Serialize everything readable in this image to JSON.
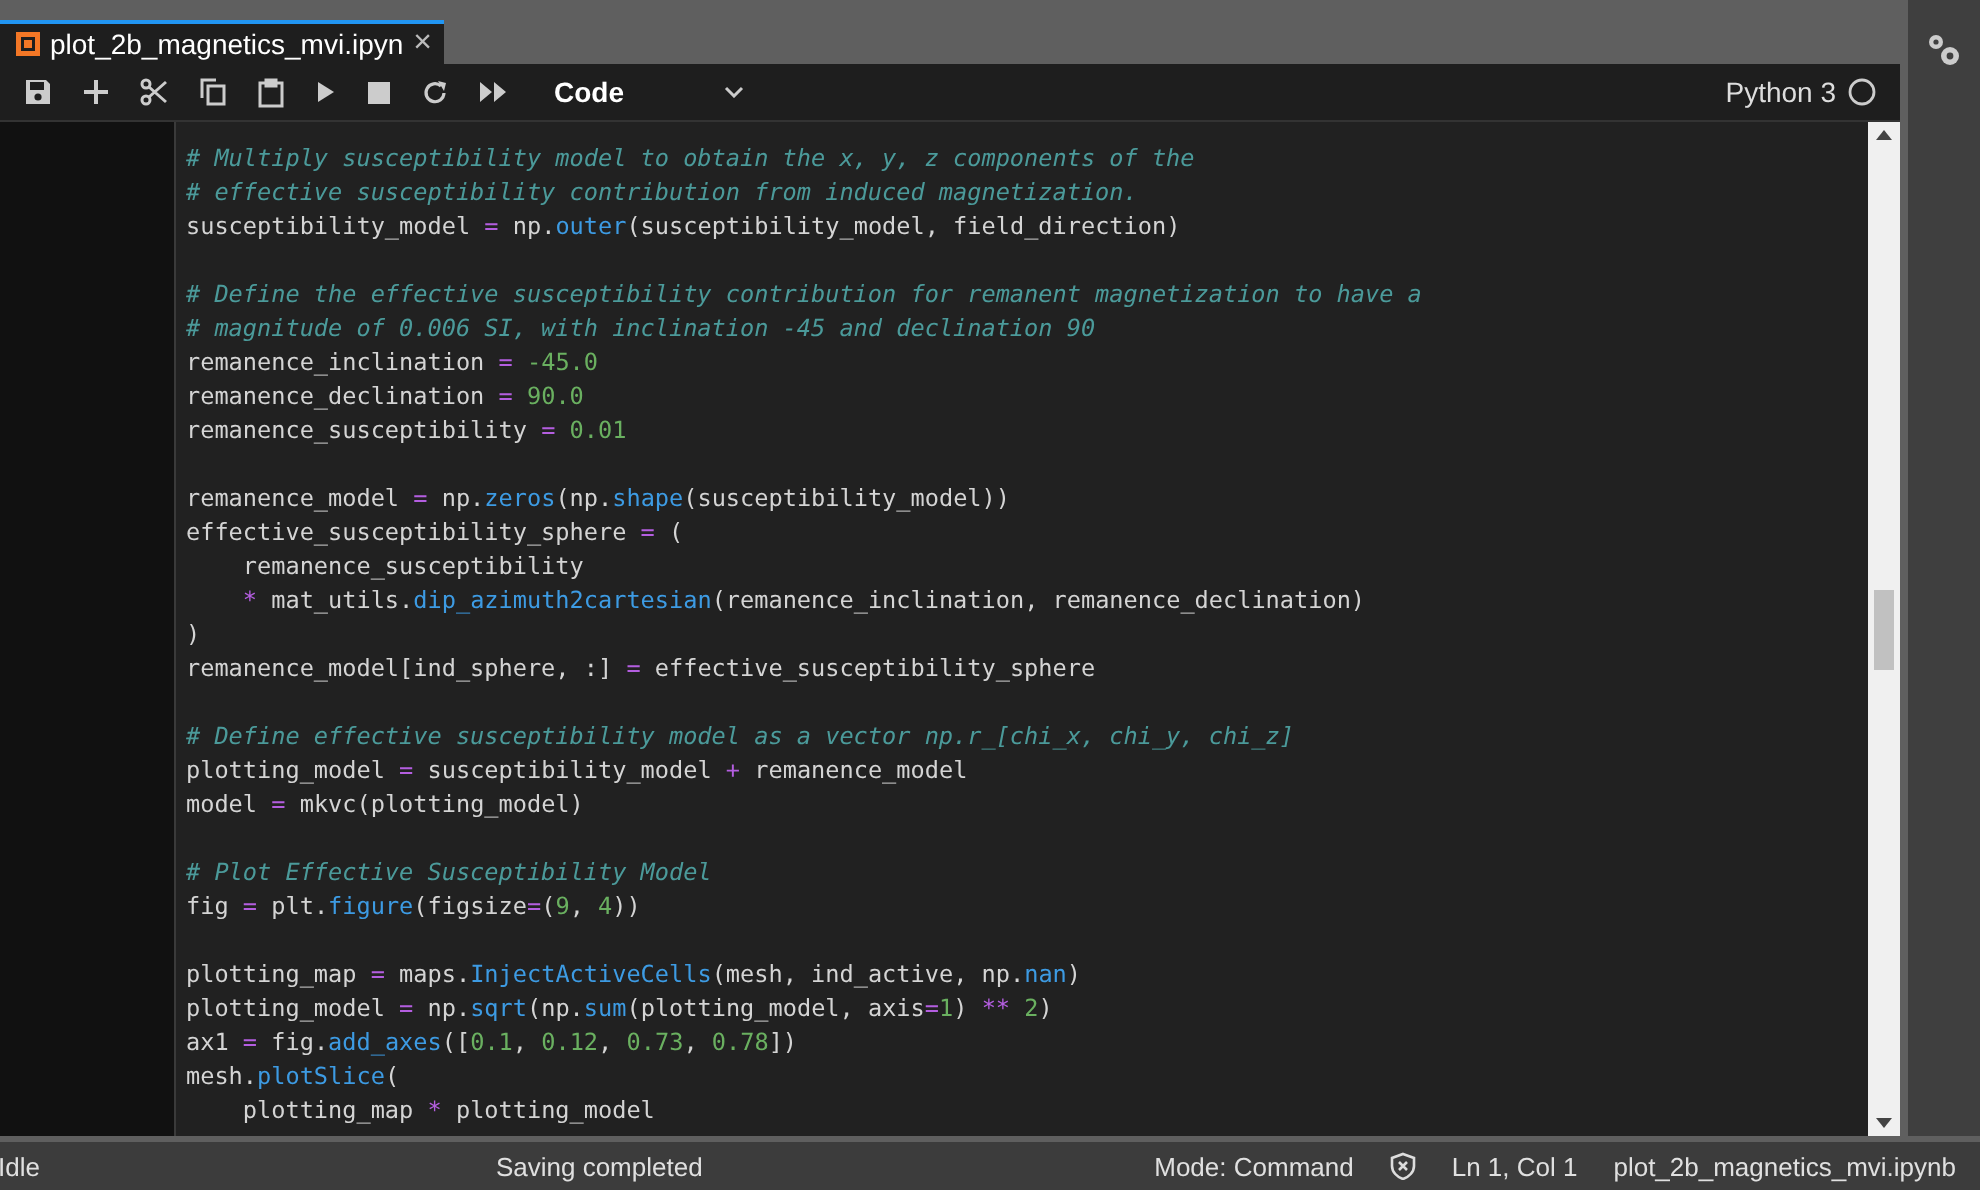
{
  "tabs": [
    {
      "label": "plot_2b_magnetics_mvi.ipyn",
      "close": "×",
      "selected": true
    }
  ],
  "toolbar": {
    "cell_type": "Code",
    "kernel": "Python 3",
    "kernel_busy": false
  },
  "editor": {
    "lines": [
      {
        "kind": "code",
        "tokens": [
          {
            "kind": "comment",
            "text": "# Multiply susceptibility model to obtain the x, y, z components of the"
          }
        ]
      },
      {
        "kind": "code",
        "tokens": [
          {
            "kind": "comment",
            "text": "# effective susceptibility contribution from induced magnetization."
          }
        ]
      },
      {
        "kind": "code",
        "tokens": [
          {
            "kind": "name",
            "text": "susceptibility_model "
          },
          {
            "kind": "op",
            "text": "="
          },
          {
            "kind": "name",
            "text": " np."
          },
          {
            "kind": "func",
            "text": "outer"
          },
          {
            "kind": "name",
            "text": "(susceptibility_model, field_direction)"
          }
        ]
      },
      {
        "kind": "blank"
      },
      {
        "kind": "code",
        "tokens": [
          {
            "kind": "comment",
            "text": "# Define the effective susceptibility contribution for remanent magnetization to have a"
          }
        ]
      },
      {
        "kind": "code",
        "tokens": [
          {
            "kind": "comment",
            "text": "# magnitude of 0.006 SI, with inclination -45 and declination 90"
          }
        ]
      },
      {
        "kind": "code",
        "tokens": [
          {
            "kind": "name",
            "text": "remanence_inclination "
          },
          {
            "kind": "op",
            "text": "= "
          },
          {
            "kind": "num",
            "text": "-45.0"
          }
        ]
      },
      {
        "kind": "code",
        "tokens": [
          {
            "kind": "name",
            "text": "remanence_declination "
          },
          {
            "kind": "op",
            "text": "= "
          },
          {
            "kind": "num",
            "text": "90.0"
          }
        ]
      },
      {
        "kind": "code",
        "tokens": [
          {
            "kind": "name",
            "text": "remanence_susceptibility "
          },
          {
            "kind": "op",
            "text": "= "
          },
          {
            "kind": "num",
            "text": "0.01"
          }
        ]
      },
      {
        "kind": "blank"
      },
      {
        "kind": "code",
        "tokens": [
          {
            "kind": "name",
            "text": "remanence_model "
          },
          {
            "kind": "op",
            "text": "="
          },
          {
            "kind": "name",
            "text": " np."
          },
          {
            "kind": "func",
            "text": "zeros"
          },
          {
            "kind": "name",
            "text": "(np."
          },
          {
            "kind": "func",
            "text": "shape"
          },
          {
            "kind": "name",
            "text": "(susceptibility_model))"
          }
        ]
      },
      {
        "kind": "code",
        "tokens": [
          {
            "kind": "name",
            "text": "effective_susceptibility_sphere "
          },
          {
            "kind": "op",
            "text": "="
          },
          {
            "kind": "name",
            "text": " ("
          }
        ]
      },
      {
        "kind": "code",
        "tokens": [
          {
            "kind": "name",
            "text": "    remanence_susceptibility"
          }
        ]
      },
      {
        "kind": "code",
        "tokens": [
          {
            "kind": "op",
            "text": "    *"
          },
          {
            "kind": "name",
            "text": " mat_utils."
          },
          {
            "kind": "func",
            "text": "dip_azimuth2cartesian"
          },
          {
            "kind": "name",
            "text": "(remanence_inclination, remanence_declination)"
          }
        ]
      },
      {
        "kind": "code",
        "tokens": [
          {
            "kind": "name",
            "text": ")"
          }
        ]
      },
      {
        "kind": "code",
        "tokens": [
          {
            "kind": "name",
            "text": "remanence_model[ind_sphere, :] "
          },
          {
            "kind": "op",
            "text": "="
          },
          {
            "kind": "name",
            "text": " effective_susceptibility_sphere"
          }
        ]
      },
      {
        "kind": "blank"
      },
      {
        "kind": "code",
        "tokens": [
          {
            "kind": "comment",
            "text": "# Define effective susceptibility model as a vector np.r_[chi_x, chi_y, chi_z]"
          }
        ]
      },
      {
        "kind": "code",
        "tokens": [
          {
            "kind": "name",
            "text": "plotting_model "
          },
          {
            "kind": "op",
            "text": "="
          },
          {
            "kind": "name",
            "text": " susceptibility_model "
          },
          {
            "kind": "op",
            "text": "+"
          },
          {
            "kind": "name",
            "text": " remanence_model"
          }
        ]
      },
      {
        "kind": "code",
        "tokens": [
          {
            "kind": "name",
            "text": "model "
          },
          {
            "kind": "op",
            "text": "="
          },
          {
            "kind": "name",
            "text": " mkvc(plotting_model)"
          }
        ]
      },
      {
        "kind": "blank"
      },
      {
        "kind": "code",
        "tokens": [
          {
            "kind": "comment",
            "text": "# Plot Effective Susceptibility Model"
          }
        ]
      },
      {
        "kind": "code",
        "tokens": [
          {
            "kind": "name",
            "text": "fig "
          },
          {
            "kind": "op",
            "text": "="
          },
          {
            "kind": "name",
            "text": " plt."
          },
          {
            "kind": "func",
            "text": "figure"
          },
          {
            "kind": "name",
            "text": "(figsize"
          },
          {
            "kind": "op",
            "text": "="
          },
          {
            "kind": "name",
            "text": "("
          },
          {
            "kind": "num",
            "text": "9"
          },
          {
            "kind": "name",
            "text": ", "
          },
          {
            "kind": "num",
            "text": "4"
          },
          {
            "kind": "name",
            "text": "))"
          }
        ]
      },
      {
        "kind": "blank"
      },
      {
        "kind": "code",
        "tokens": [
          {
            "kind": "name",
            "text": "plotting_map "
          },
          {
            "kind": "op",
            "text": "="
          },
          {
            "kind": "name",
            "text": " maps."
          },
          {
            "kind": "func",
            "text": "InjectActiveCells"
          },
          {
            "kind": "name",
            "text": "(mesh, ind_active, np."
          },
          {
            "kind": "func",
            "text": "nan"
          },
          {
            "kind": "name",
            "text": ")"
          }
        ]
      },
      {
        "kind": "code",
        "tokens": [
          {
            "kind": "name",
            "text": "plotting_model "
          },
          {
            "kind": "op",
            "text": "="
          },
          {
            "kind": "name",
            "text": " np."
          },
          {
            "kind": "func",
            "text": "sqrt"
          },
          {
            "kind": "name",
            "text": "(np."
          },
          {
            "kind": "func",
            "text": "sum"
          },
          {
            "kind": "name",
            "text": "(plotting_model, axis"
          },
          {
            "kind": "op",
            "text": "="
          },
          {
            "kind": "num",
            "text": "1"
          },
          {
            "kind": "name",
            "text": ") "
          },
          {
            "kind": "op",
            "text": "** "
          },
          {
            "kind": "num",
            "text": "2"
          },
          {
            "kind": "name",
            "text": ")"
          }
        ]
      },
      {
        "kind": "code",
        "tokens": [
          {
            "kind": "name",
            "text": "ax1 "
          },
          {
            "kind": "op",
            "text": "="
          },
          {
            "kind": "name",
            "text": " fig."
          },
          {
            "kind": "func",
            "text": "add_axes"
          },
          {
            "kind": "name",
            "text": "(["
          },
          {
            "kind": "num",
            "text": "0.1"
          },
          {
            "kind": "name",
            "text": ", "
          },
          {
            "kind": "num",
            "text": "0.12"
          },
          {
            "kind": "name",
            "text": ", "
          },
          {
            "kind": "num",
            "text": "0.73"
          },
          {
            "kind": "name",
            "text": ", "
          },
          {
            "kind": "num",
            "text": "0.78"
          },
          {
            "kind": "name",
            "text": "])"
          }
        ]
      },
      {
        "kind": "code",
        "tokens": [
          {
            "kind": "name",
            "text": "mesh."
          },
          {
            "kind": "func",
            "text": "plotSlice"
          },
          {
            "kind": "name",
            "text": "("
          }
        ]
      },
      {
        "kind": "code",
        "tokens": [
          {
            "kind": "name",
            "text": "    plotting_map "
          },
          {
            "kind": "op",
            "text": "*"
          },
          {
            "kind": "name",
            "text": " plotting_model"
          }
        ]
      }
    ]
  },
  "status_bar": {
    "state": "Idle",
    "message": "Saving completed",
    "mode": "Mode: Command",
    "position": "Ln 1, Col 1",
    "file": "plot_2b_magnetics_mvi.ipynb"
  }
}
